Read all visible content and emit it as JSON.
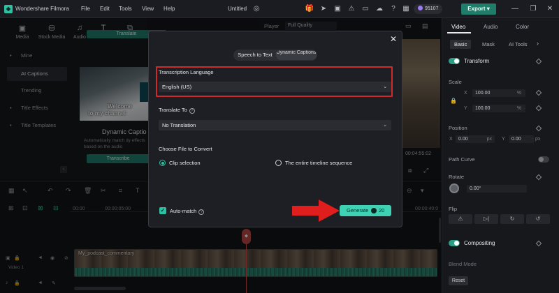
{
  "app": {
    "name": "Wondershare Filmora",
    "menus": [
      "File",
      "Edit",
      "Tools",
      "View",
      "Help"
    ],
    "project_title": "Untitled",
    "credits": "95107",
    "export_label": "Export"
  },
  "media_toolbar": [
    {
      "label": "Media",
      "icon": "media-icon"
    },
    {
      "label": "Stock Media",
      "icon": "stock-media-icon"
    },
    {
      "label": "Audio",
      "icon": "audio-note-icon"
    },
    {
      "label": "Titles",
      "icon": "titles-icon"
    },
    {
      "label": "Transitions",
      "icon": "transitions-icon"
    }
  ],
  "sidebar": {
    "items": [
      {
        "label": "Mine",
        "arrow": "▸"
      },
      {
        "label": "AI Captions",
        "selected": true
      },
      {
        "label": "Trending"
      },
      {
        "label": "Title Effects",
        "arrow": "▸"
      },
      {
        "label": "Title Templates",
        "arrow": "▸"
      }
    ]
  },
  "caption_cards": {
    "translate_label": "Translate",
    "thumb_text_1": "Welcome",
    "thumb_text_2": "to my channel",
    "dynamic_title": "Dynamic Captio",
    "dynamic_desc": "Automatically match dy effects based on the audio",
    "transcribe_label": "Transcribe"
  },
  "player": {
    "label": "Player",
    "quality": "Full Quality",
    "time": "00:04:55:02"
  },
  "right_panel": {
    "tabs": [
      "Video",
      "Audio",
      "Color"
    ],
    "subtabs": [
      "Basic",
      "Mask",
      "AI Tools"
    ],
    "transform_label": "Transform",
    "scale_label": "Scale",
    "scale_x_label": "X",
    "scale_x": "100.00",
    "scale_y_label": "Y",
    "scale_y": "100.00",
    "percent": "%",
    "position_label": "Position",
    "pos_x_label": "X",
    "pos_x": "0.00",
    "pos_y_label": "Y",
    "pos_y": "0.00",
    "px_unit": "px",
    "path_curve_label": "Path Curve",
    "rotate_label": "Rotate",
    "rotate_value": "0.00°",
    "flip_label": "Flip",
    "compositing_label": "Compositing",
    "blend_mode_label": "Blend Mode",
    "reset_label": "Reset"
  },
  "timeline": {
    "ruler": [
      "00:00",
      "00:00:05:00",
      "00:00:40:0"
    ],
    "clip_label": "My_podcast_commentary",
    "track_name": "Video 1"
  },
  "modal": {
    "tab_stt": "Speech to Text",
    "tab_dynamic": "Dynamic Captions",
    "transcription_label": "Transcription Language",
    "transcription_value": "English (US)",
    "translate_label": "Translate To",
    "translate_value": "No Translation",
    "choose_label": "Choose File to Convert",
    "option_clip": "Clip selection",
    "option_timeline": "The entire timeline sequence",
    "automatch_label": "Auto-match",
    "generate_label": "Generate",
    "generate_cost": "20"
  },
  "colors": {
    "accent": "#3fd1b4",
    "brand_green": "#1f7d6a",
    "highlight_red": "#d12a2a",
    "playhead": "#d64a4a"
  }
}
